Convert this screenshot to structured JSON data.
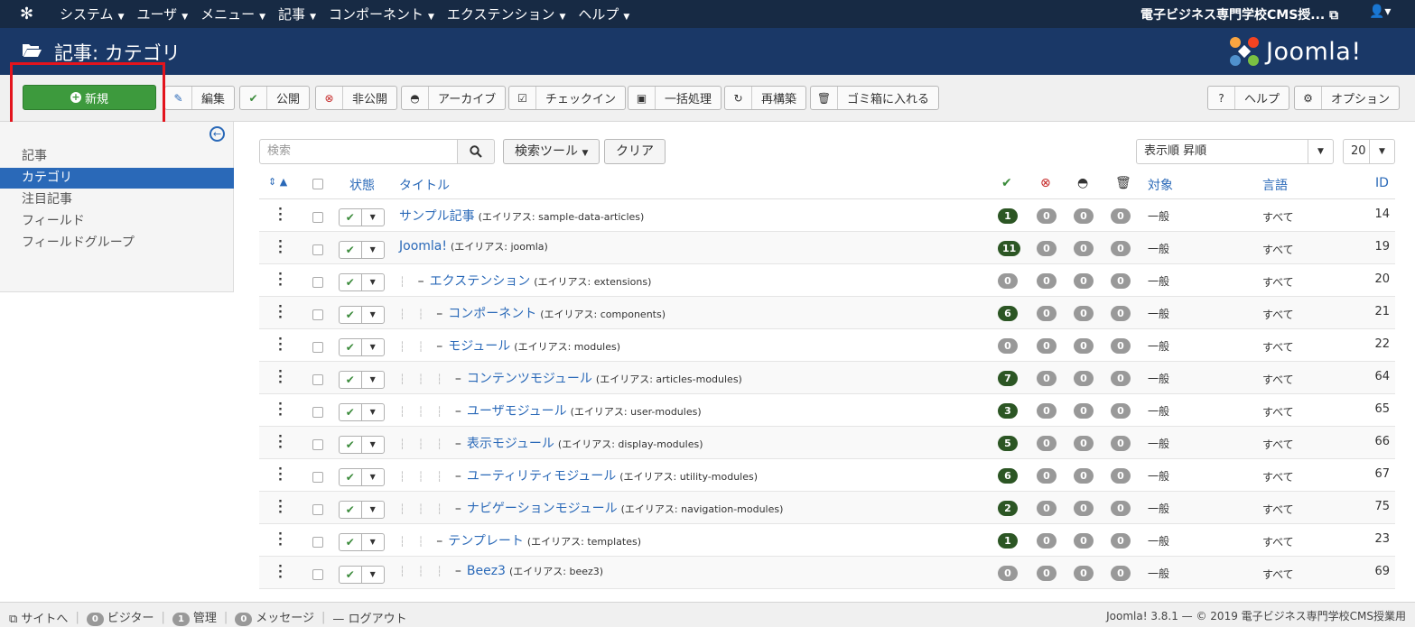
{
  "topnav": {
    "menu": [
      "システム",
      "ユーザ",
      "メニュー",
      "記事",
      "コンポーネント",
      "エクステンション",
      "ヘルプ"
    ],
    "site_name": "電子ビジネス専門学校CMS授..."
  },
  "header": {
    "title": "記事: カテゴリ",
    "brand": "Joomla!"
  },
  "toolbar": {
    "new": "新規",
    "edit": "編集",
    "publish": "公開",
    "unpublish": "非公開",
    "archive": "アーカイブ",
    "checkin": "チェックイン",
    "batch": "一括処理",
    "rebuild": "再構築",
    "trash": "ゴミ箱に入れる",
    "help": "ヘルプ",
    "options": "オプション"
  },
  "sidebar": {
    "items": [
      "記事",
      "カテゴリ",
      "注目記事",
      "フィールド",
      "フィールドグループ"
    ],
    "active": "カテゴリ"
  },
  "filters": {
    "search_placeholder": "検索",
    "search_tools": "検索ツール",
    "clear": "クリア",
    "ordering": "表示順 昇順",
    "limit": "20"
  },
  "columns": {
    "status": "状態",
    "title": "タイトル",
    "access": "対象",
    "language": "言語",
    "id": "ID"
  },
  "rows": [
    {
      "level": 1,
      "name": "サンプル記事",
      "alias": "(エイリアス: sample-data-articles)",
      "published": "1",
      "unpublished": "0",
      "archived": "0",
      "trashed": "0",
      "access": "一般",
      "language": "すべて",
      "id": "14"
    },
    {
      "level": 1,
      "name": "Joomla!",
      "alias": "(エイリアス: joomla)",
      "published": "11",
      "unpublished": "0",
      "archived": "0",
      "trashed": "0",
      "access": "一般",
      "language": "すべて",
      "id": "19"
    },
    {
      "level": 2,
      "name": "エクステンション",
      "alias": "(エイリアス: extensions)",
      "published": "0",
      "unpublished": "0",
      "archived": "0",
      "trashed": "0",
      "access": "一般",
      "language": "すべて",
      "id": "20"
    },
    {
      "level": 3,
      "name": "コンポーネント",
      "alias": "(エイリアス: components)",
      "published": "6",
      "unpublished": "0",
      "archived": "0",
      "trashed": "0",
      "access": "一般",
      "language": "すべて",
      "id": "21"
    },
    {
      "level": 3,
      "name": "モジュール",
      "alias": "(エイリアス: modules)",
      "published": "0",
      "unpublished": "0",
      "archived": "0",
      "trashed": "0",
      "access": "一般",
      "language": "すべて",
      "id": "22"
    },
    {
      "level": 4,
      "name": "コンテンツモジュール",
      "alias": "(エイリアス: articles-modules)",
      "published": "7",
      "unpublished": "0",
      "archived": "0",
      "trashed": "0",
      "access": "一般",
      "language": "すべて",
      "id": "64"
    },
    {
      "level": 4,
      "name": "ユーザモジュール",
      "alias": "(エイリアス: user-modules)",
      "published": "3",
      "unpublished": "0",
      "archived": "0",
      "trashed": "0",
      "access": "一般",
      "language": "すべて",
      "id": "65"
    },
    {
      "level": 4,
      "name": "表示モジュール",
      "alias": "(エイリアス: display-modules)",
      "published": "5",
      "unpublished": "0",
      "archived": "0",
      "trashed": "0",
      "access": "一般",
      "language": "すべて",
      "id": "66"
    },
    {
      "level": 4,
      "name": "ユーティリティモジュール",
      "alias": "(エイリアス: utility-modules)",
      "published": "6",
      "unpublished": "0",
      "archived": "0",
      "trashed": "0",
      "access": "一般",
      "language": "すべて",
      "id": "67"
    },
    {
      "level": 4,
      "name": "ナビゲーションモジュール",
      "alias": "(エイリアス: navigation-modules)",
      "published": "2",
      "unpublished": "0",
      "archived": "0",
      "trashed": "0",
      "access": "一般",
      "language": "すべて",
      "id": "75"
    },
    {
      "level": 3,
      "name": "テンプレート",
      "alias": "(エイリアス: templates)",
      "published": "1",
      "unpublished": "0",
      "archived": "0",
      "trashed": "0",
      "access": "一般",
      "language": "すべて",
      "id": "23"
    },
    {
      "level": 4,
      "name": "Beez3",
      "alias": "(エイリアス: beez3)",
      "published": "0",
      "unpublished": "0",
      "archived": "0",
      "trashed": "0",
      "access": "一般",
      "language": "すべて",
      "id": "69"
    }
  ],
  "footer": {
    "site": "サイトへ",
    "visitors_count": "0",
    "visitors": "ビジター",
    "admins_count": "1",
    "admins": "管理",
    "messages_count": "0",
    "messages": "メッセージ",
    "logout": "ログアウト",
    "version": "Joomla! 3.8.1 — © 2019 電子ビジネス専門学校CMS授業用"
  },
  "colors": {
    "topnav": "#172a44",
    "header": "#1a3867",
    "new_button": "#3d9a3d",
    "active": "#2a69b8",
    "badge_on": "#2c5624",
    "highlight": "#e3141d"
  }
}
